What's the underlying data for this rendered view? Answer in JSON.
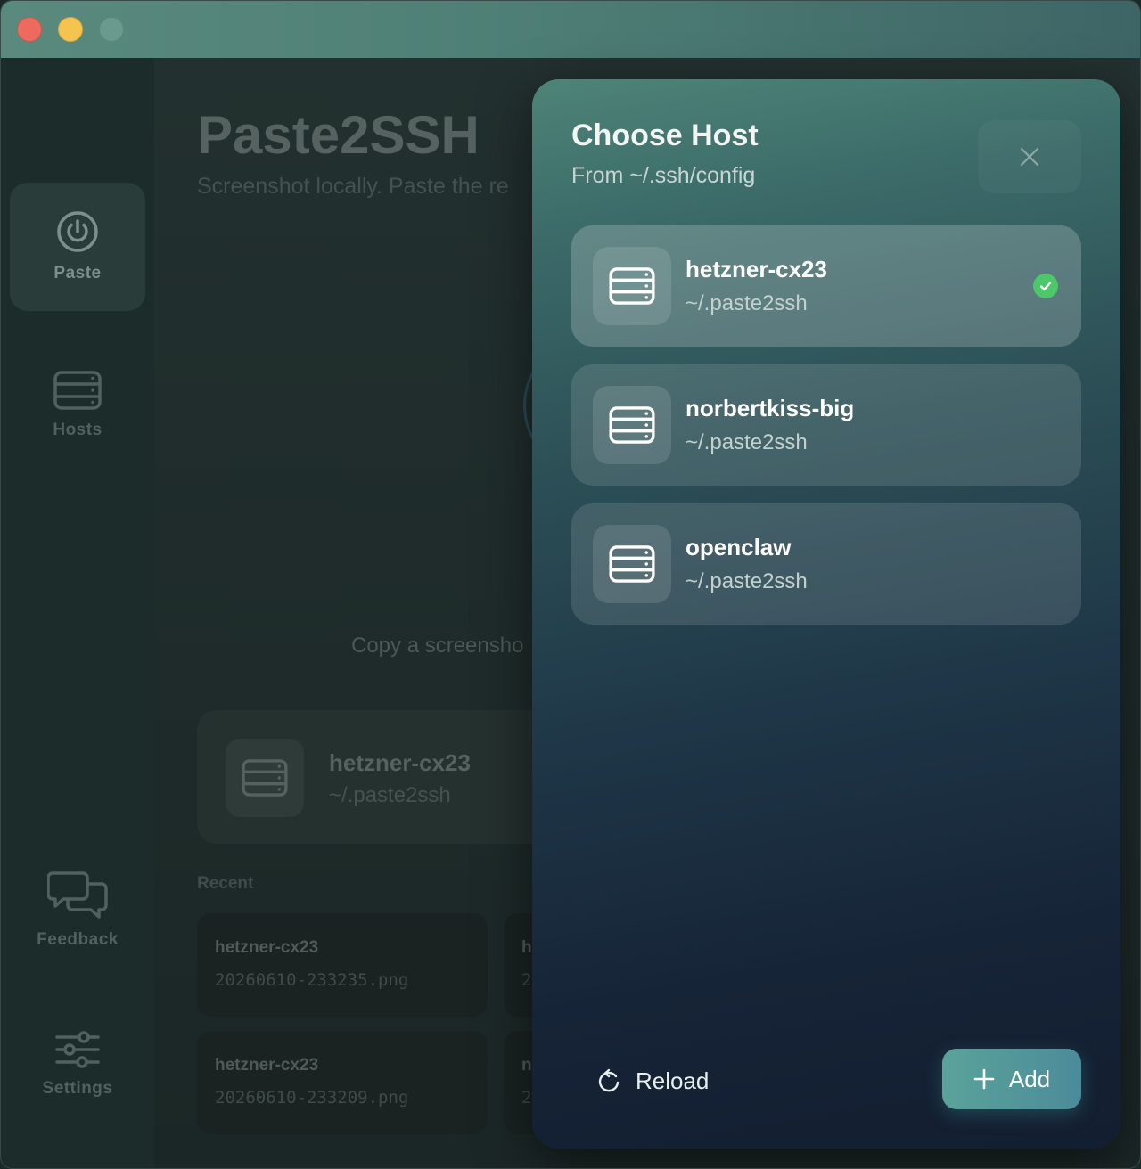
{
  "window": {
    "traffic_lights": [
      "close",
      "minimize",
      "zoom"
    ]
  },
  "sidebar": {
    "items": [
      {
        "label": "Paste",
        "icon": "power-icon",
        "active": true
      },
      {
        "label": "Hosts",
        "icon": "server-icon",
        "active": false
      },
      {
        "label": "Feedback",
        "icon": "chat-bubbles-icon",
        "active": false
      },
      {
        "label": "Settings",
        "icon": "sliders-icon",
        "active": false
      }
    ]
  },
  "main": {
    "title": "Paste2SSH",
    "subtitle": "Screenshot locally. Paste the re",
    "hint": "Copy a screensho",
    "current_host": {
      "name": "hetzner-cx23",
      "path": "~/.paste2ssh"
    },
    "recent_label": "Recent",
    "recent": [
      {
        "host": "hetzner-cx23",
        "file": "20260610-233235.png"
      },
      {
        "host": "h",
        "file": "2"
      },
      {
        "host": "hetzner-cx23",
        "file": "20260610-233209.png"
      },
      {
        "host": "n",
        "file": "2"
      }
    ]
  },
  "dialog": {
    "title": "Choose Host",
    "subtitle": "From ~/.ssh/config",
    "hosts": [
      {
        "name": "hetzner-cx23",
        "path": "~/.paste2ssh",
        "selected": true
      },
      {
        "name": "norbertkiss-big",
        "path": "~/.paste2ssh",
        "selected": false
      },
      {
        "name": "openclaw",
        "path": "~/.paste2ssh",
        "selected": false
      }
    ],
    "reload_label": "Reload",
    "add_label": "Add"
  },
  "colors": {
    "accent": "#4cc76a",
    "add_button": "#5aa39a"
  }
}
